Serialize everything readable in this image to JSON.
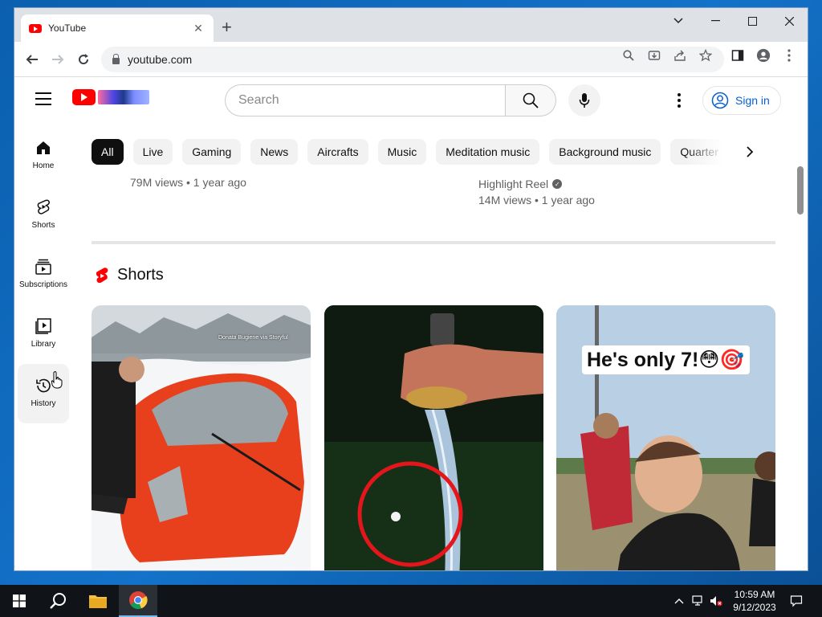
{
  "browser": {
    "tab_title": "YouTube",
    "url": "youtube.com"
  },
  "youtube": {
    "search_placeholder": "Search",
    "sign_in": "Sign in",
    "sidebar": [
      {
        "label": "Home",
        "icon": "home-icon"
      },
      {
        "label": "Shorts",
        "icon": "shorts-icon"
      },
      {
        "label": "Subscriptions",
        "icon": "subscriptions-icon"
      },
      {
        "label": "Library",
        "icon": "library-icon"
      },
      {
        "label": "History",
        "icon": "history-icon"
      }
    ],
    "chips": [
      "All",
      "Live",
      "Gaming",
      "News",
      "Aircrafts",
      "Music",
      "Meditation music",
      "Background music",
      "Quarter"
    ],
    "video_left_meta": "79M views • 1 year ago",
    "video_right_channel": "Highlight Reel",
    "video_right_meta": "14M views • 1 year ago",
    "shorts_title": "Shorts",
    "shorts": [
      {
        "overlay_text": "Donata Bugiene via Storyful",
        "theme": "red car in snow"
      },
      {
        "overlay_text": "",
        "theme": "sword and ball"
      },
      {
        "overlay_text": "He's only 7!😳🎯",
        "theme": "kid on field"
      }
    ]
  },
  "taskbar": {
    "time": "10:59 AM",
    "date": "9/12/2023"
  },
  "colors": {
    "yt_red": "#ff0000",
    "link_blue": "#065fd4",
    "taskbar": "#101418"
  }
}
